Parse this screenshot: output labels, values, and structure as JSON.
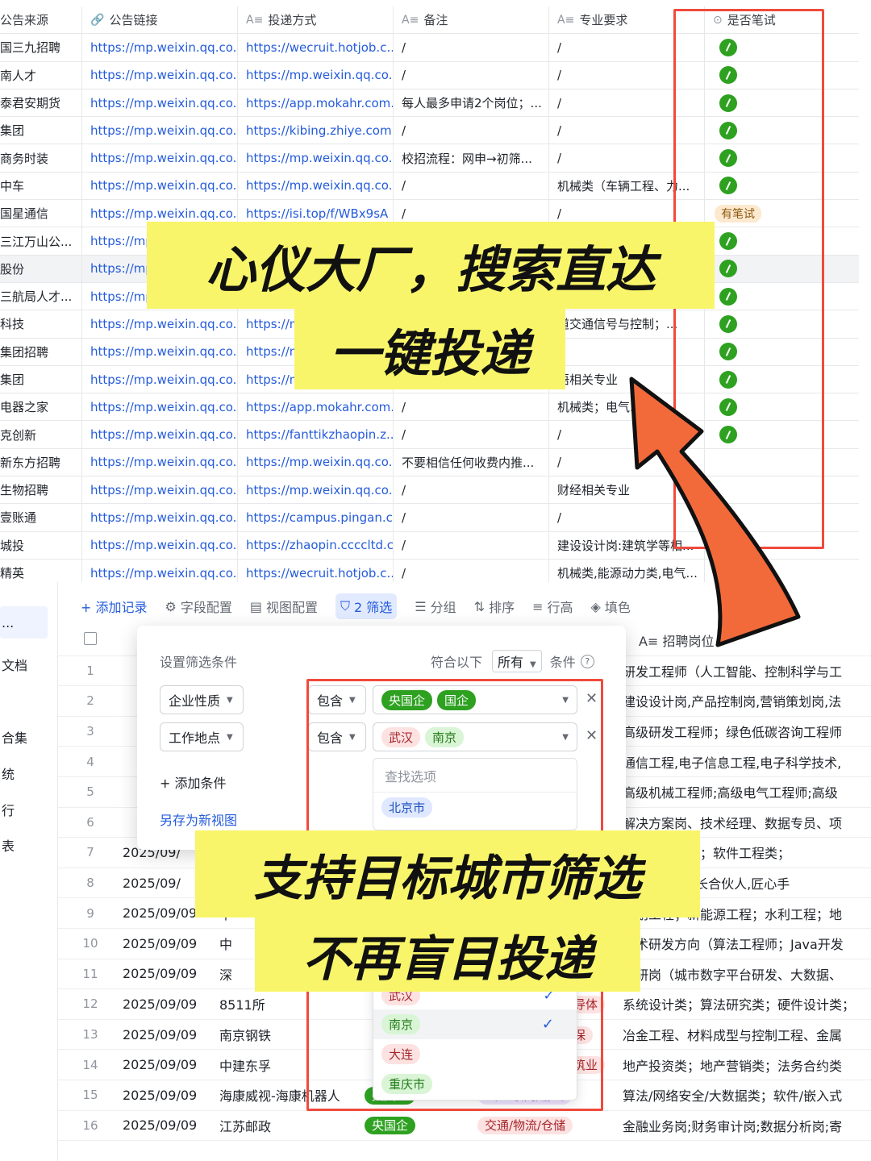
{
  "table_top": {
    "headers": [
      {
        "icon": "",
        "label": "公告来源"
      },
      {
        "icon": "🔗",
        "label": "公告链接"
      },
      {
        "icon": "A≡",
        "label": "投递方式"
      },
      {
        "icon": "A≡",
        "label": "备注"
      },
      {
        "icon": "A≡",
        "label": "专业要求"
      },
      {
        "icon": "⊙",
        "label": "是否笔试"
      }
    ],
    "rows": [
      {
        "src": "国三九招聘",
        "link": "https://mp.weixin.qq.co...",
        "method": "https://wecruit.hotjob.c...",
        "note": "/",
        "major": "/",
        "exam": "ok"
      },
      {
        "src": "南人才",
        "link": "https://mp.weixin.qq.co...",
        "method": "https://mp.weixin.qq.co...",
        "note": "/",
        "major": "/",
        "exam": "ok"
      },
      {
        "src": "泰君安期货",
        "link": "https://mp.weixin.qq.co...",
        "method": "https://app.mokahr.com...",
        "note": "每人最多申请2个岗位；...",
        "major": "/",
        "exam": "ok"
      },
      {
        "src": "集团",
        "link": "https://mp.weixin.qq.co...",
        "method": "https://kibing.zhiye.com...",
        "note": "/",
        "major": "/",
        "exam": "ok"
      },
      {
        "src": "商务时装",
        "link": "https://mp.weixin.qq.co...",
        "method": "https://mp.weixin.qq.co...",
        "note": "校招流程：网申→初筛...",
        "major": "/",
        "exam": "ok"
      },
      {
        "src": "中车",
        "link": "https://mp.weixin.qq.co...",
        "method": "https://mp.weixin.qq.co...",
        "note": "/",
        "major": "机械类（车辆工程、力...",
        "exam": "ok"
      },
      {
        "src": "国星通信",
        "link": "https://mp.weixin.qq.co...",
        "method": "https://isi.top/f/WBx9sA",
        "note": "/",
        "major": "/",
        "exam": "有笔试"
      },
      {
        "src": "三江万山公...",
        "link": "https://mp",
        "method": "",
        "note": "",
        "major": "",
        "exam": "ok"
      },
      {
        "src": "股份",
        "link": "https://mp",
        "method": "",
        "note": "",
        "major": "",
        "exam": "ok"
      },
      {
        "src": "三航局人才...",
        "link": "https://mp",
        "method": "",
        "note": "",
        "major": "",
        "exam": "ok"
      },
      {
        "src": "科技",
        "link": "https://mp.weixin.qq.co...",
        "method": "https://m",
        "note": "",
        "major": "道交通信号与控制；...",
        "exam": "ok"
      },
      {
        "src": "集团招聘",
        "link": "https://mp.weixin.qq.co...",
        "method": "https://m",
        "note": "",
        "major": "",
        "exam": "ok"
      },
      {
        "src": "集团",
        "link": "https://mp.weixin.qq.co...",
        "method": "https://m",
        "note": "",
        "major": "语相关专业",
        "exam": "ok"
      },
      {
        "src": "电器之家",
        "link": "https://mp.weixin.qq.co...",
        "method": "https://app.mokahr.com...",
        "note": "/",
        "major": "机械类；电气...",
        "exam": "ok"
      },
      {
        "src": "克创新",
        "link": "https://mp.weixin.qq.co...",
        "method": "https://fanttikzhaopin.z...",
        "note": "/",
        "major": "/",
        "exam": "ok"
      },
      {
        "src": "新东方招聘",
        "link": "https://mp.weixin.qq.co...",
        "method": "https://mp.weixin.qq.co...",
        "note": "不要相信任何收费内推...",
        "major": "/",
        "exam": ""
      },
      {
        "src": "生物招聘",
        "link": "https://mp.weixin.qq.co...",
        "method": "https://mp.weixin.qq.co...",
        "note": "/",
        "major": "财经相关专业",
        "exam": ""
      },
      {
        "src": "壹账通",
        "link": "https://mp.weixin.qq.co...",
        "method": "https://campus.pingan.c...",
        "note": "/",
        "major": "/",
        "exam": ""
      },
      {
        "src": "城投",
        "link": "https://mp.weixin.qq.co...",
        "method": "https://zhaopin.ccccltd.c...",
        "note": "/",
        "major": "建设设计岗:建筑学等相...",
        "exam": ""
      },
      {
        "src": "精英",
        "link": "https://mp.weixin.qq.co...",
        "method": "https://wecruit.hotjob.c...",
        "note": "/",
        "major": "机械类,能源动力类,电气...",
        "exam": ""
      }
    ]
  },
  "toolbar": {
    "add": "+ 添加记录",
    "fields": "字段配置",
    "views": "视图配置",
    "filter": "2 筛选",
    "group": "分组",
    "sort": "排序",
    "rowheight": "行高",
    "fill": "填色"
  },
  "sidebar": [
    "...",
    "文档",
    "",
    "合集",
    "统",
    "行",
    "表"
  ],
  "filter_panel": {
    "title": "设置筛选条件",
    "match_label": "符合以下",
    "match_value": "所有",
    "cond_label": "条件",
    "cond1_field": "企业性质",
    "cond1_op": "包含",
    "cond1_values": [
      "央国企",
      "国企"
    ],
    "cond2_field": "工作地点",
    "cond2_op": "包含",
    "cond2_values": [
      "武汉",
      "南京"
    ],
    "add_cond": "+ 添加条件",
    "save_view": "另存为新视图",
    "search_placeholder": "查找选项",
    "opt_top": "北京市",
    "opts_bottom": [
      "武汉",
      "南京",
      "大连",
      "重庆市"
    ]
  },
  "table_bottom": {
    "col_header": "A≡ 招聘岗位",
    "rows": [
      {
        "n": "1",
        "date": "",
        "co": "",
        "nat": "",
        "ind": "",
        "pos": "研发工程师（人工智能、控制科学与工"
      },
      {
        "n": "2",
        "date": "",
        "co": "",
        "nat": "",
        "ind": "",
        "pos": "建设设计岗,产品控制岗,营销策划岗,法"
      },
      {
        "n": "3",
        "date": "",
        "co": "",
        "nat": "",
        "ind": "",
        "pos": "高级研发工程师；绿色低碳咨询工程师"
      },
      {
        "n": "4",
        "date": "",
        "co": "",
        "nat": "",
        "ind": "",
        "pos": "通信工程,电子信息工程,电子科学技术,"
      },
      {
        "n": "5",
        "date": "",
        "co": "",
        "nat": "",
        "ind": "",
        "pos": "高级机械工程师;高级电气工程师;高级"
      },
      {
        "n": "6",
        "date": "",
        "co": "",
        "nat": "",
        "ind": "",
        "pos": "解决方案岗、技术经理、数据专员、项"
      },
      {
        "n": "7",
        "date": "2025/09/",
        "co": "",
        "nat": "",
        "ind": "",
        "pos": "；网络安全类；软件工程类；"
      },
      {
        "n": "8",
        "date": "2025/09/",
        "co": "",
        "nat": "",
        "ind": "",
        "pos": ",极客先锋,成长合伙人,匠心手"
      },
      {
        "n": "9",
        "date": "2025/09/09",
        "co": "中",
        "nat": "",
        "ind": "",
        "pos": "规划工程；新能源工程；水利工程；地"
      },
      {
        "n": "10",
        "date": "2025/09/09",
        "co": "中",
        "nat": "",
        "ind": "",
        "pos": "技术研发方向（算法工程师；Java开发"
      },
      {
        "n": "11",
        "date": "2025/09/09",
        "co": "深",
        "nat": "",
        "ind": "",
        "pos": "科研岗（城市数字平台研发、大数据、"
      },
      {
        "n": "12",
        "date": "2025/09/09",
        "co": "8511所",
        "nat": "",
        "ind": "导体",
        "pos": "系统设计类；算法研究类；硬件设计类；"
      },
      {
        "n": "13",
        "date": "2025/09/09",
        "co": "南京钢铁",
        "nat": "",
        "ind": "保",
        "pos": "冶金工程、材料成型与控制工程、金属"
      },
      {
        "n": "14",
        "date": "2025/09/09",
        "co": "中建东孚",
        "nat": "",
        "ind": "筑业",
        "pos": "地产投资类；地产营销类；法务合约类"
      },
      {
        "n": "15",
        "date": "2025/09/09",
        "co": "海康威视-海康机器人",
        "nat": "央国企",
        "ind": "IT/互联网/游戏",
        "pos": "算法/网络安全/大数据类；软件/嵌入式"
      },
      {
        "n": "16",
        "date": "2025/09/09",
        "co": "江苏邮政",
        "nat": "央国企",
        "ind": "交通/物流/仓储",
        "pos": "金融业务岗;财务审计岗;数据分析岗;寄"
      }
    ]
  },
  "banners": {
    "top_line1": "心仪大厂，搜索直达",
    "top_line2": "一键投递",
    "bottom_line1": "支持目标城市筛选",
    "bottom_line2": "不再盲目投递"
  },
  "colors": {
    "highlight": "#f04a3c",
    "banner": "#f8f56a",
    "arrow": "#f26a3a",
    "ok": "#2ea121",
    "link": "#245bdb"
  }
}
